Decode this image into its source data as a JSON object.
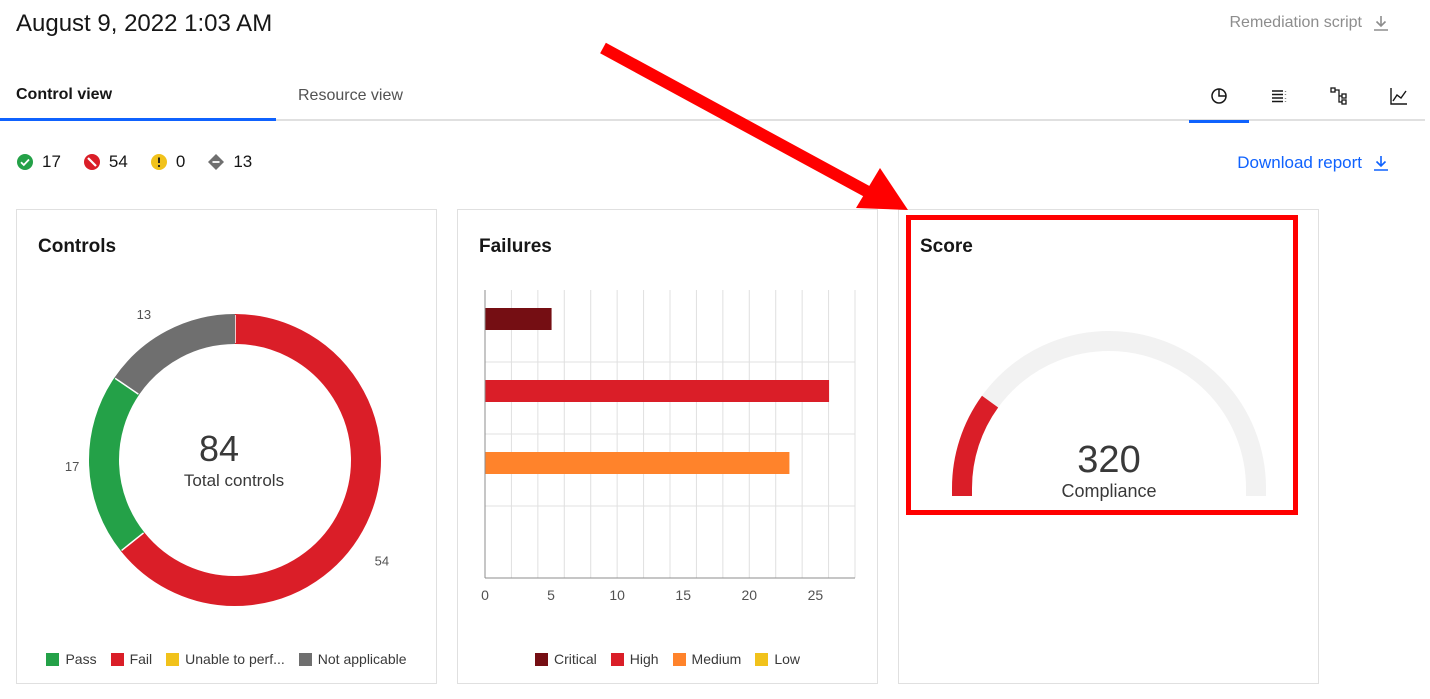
{
  "header": {
    "timestamp": "August 9, 2022 1:03 AM",
    "remediation_label": "Remediation script",
    "remediation_icon": "download-icon"
  },
  "tabs": [
    {
      "label": "Control view",
      "active": true
    },
    {
      "label": "Resource view",
      "active": false
    }
  ],
  "view_icons": [
    "pie-chart-icon",
    "list-icon",
    "tree-icon",
    "line-chart-icon"
  ],
  "status_counts": [
    {
      "icon": "check-circle-icon",
      "color": "#24a148",
      "count": "17"
    },
    {
      "icon": "blocked-circle-icon",
      "color": "#da1e28",
      "count": "54"
    },
    {
      "icon": "warning-circle-icon",
      "color": "#f1c21b",
      "count": "0"
    },
    {
      "icon": "diamond-icon",
      "color": "#6f6f6f",
      "count": "13"
    }
  ],
  "download_label": "Download report",
  "controls_card": {
    "title": "Controls",
    "center_value": "84",
    "center_label": "Total controls",
    "legend": [
      {
        "label": "Pass",
        "color": "#24a148"
      },
      {
        "label": "Fail",
        "color": "#da1e28"
      },
      {
        "label": "Unable to perf...",
        "color": "#f1c21b"
      },
      {
        "label": "Not applicable",
        "color": "#6f6f6f"
      }
    ]
  },
  "failures_card": {
    "title": "Failures",
    "legend": [
      {
        "label": "Critical",
        "color": "#750e13"
      },
      {
        "label": "High",
        "color": "#da1e28"
      },
      {
        "label": "Medium",
        "color": "#ff832b"
      },
      {
        "label": "Low",
        "color": "#f1c21b"
      }
    ]
  },
  "score_card": {
    "title": "Score",
    "value": "320",
    "label": "Compliance",
    "fill_fraction": 0.2
  },
  "chart_data": [
    {
      "type": "pie",
      "variant": "donut",
      "title": "Controls",
      "categories": [
        "Pass",
        "Fail",
        "Unable to perf...",
        "Not applicable"
      ],
      "values": [
        17,
        54,
        0,
        13
      ],
      "colors": [
        "#24a148",
        "#da1e28",
        "#f1c21b",
        "#6f6f6f"
      ],
      "labels": [
        "17",
        "54",
        "",
        "13"
      ]
    },
    {
      "type": "bar",
      "orientation": "horizontal",
      "title": "Failures",
      "categories": [
        "Critical",
        "High",
        "Medium",
        "Low"
      ],
      "values": [
        5,
        26,
        23,
        0
      ],
      "colors": [
        "#750e13",
        "#da1e28",
        "#ff832b",
        "#f1c21b"
      ],
      "xlim": [
        0,
        28
      ],
      "xticks": [
        "0",
        "5",
        "10",
        "15",
        "20",
        "25"
      ],
      "grid": true,
      "legend": "bottom"
    }
  ]
}
